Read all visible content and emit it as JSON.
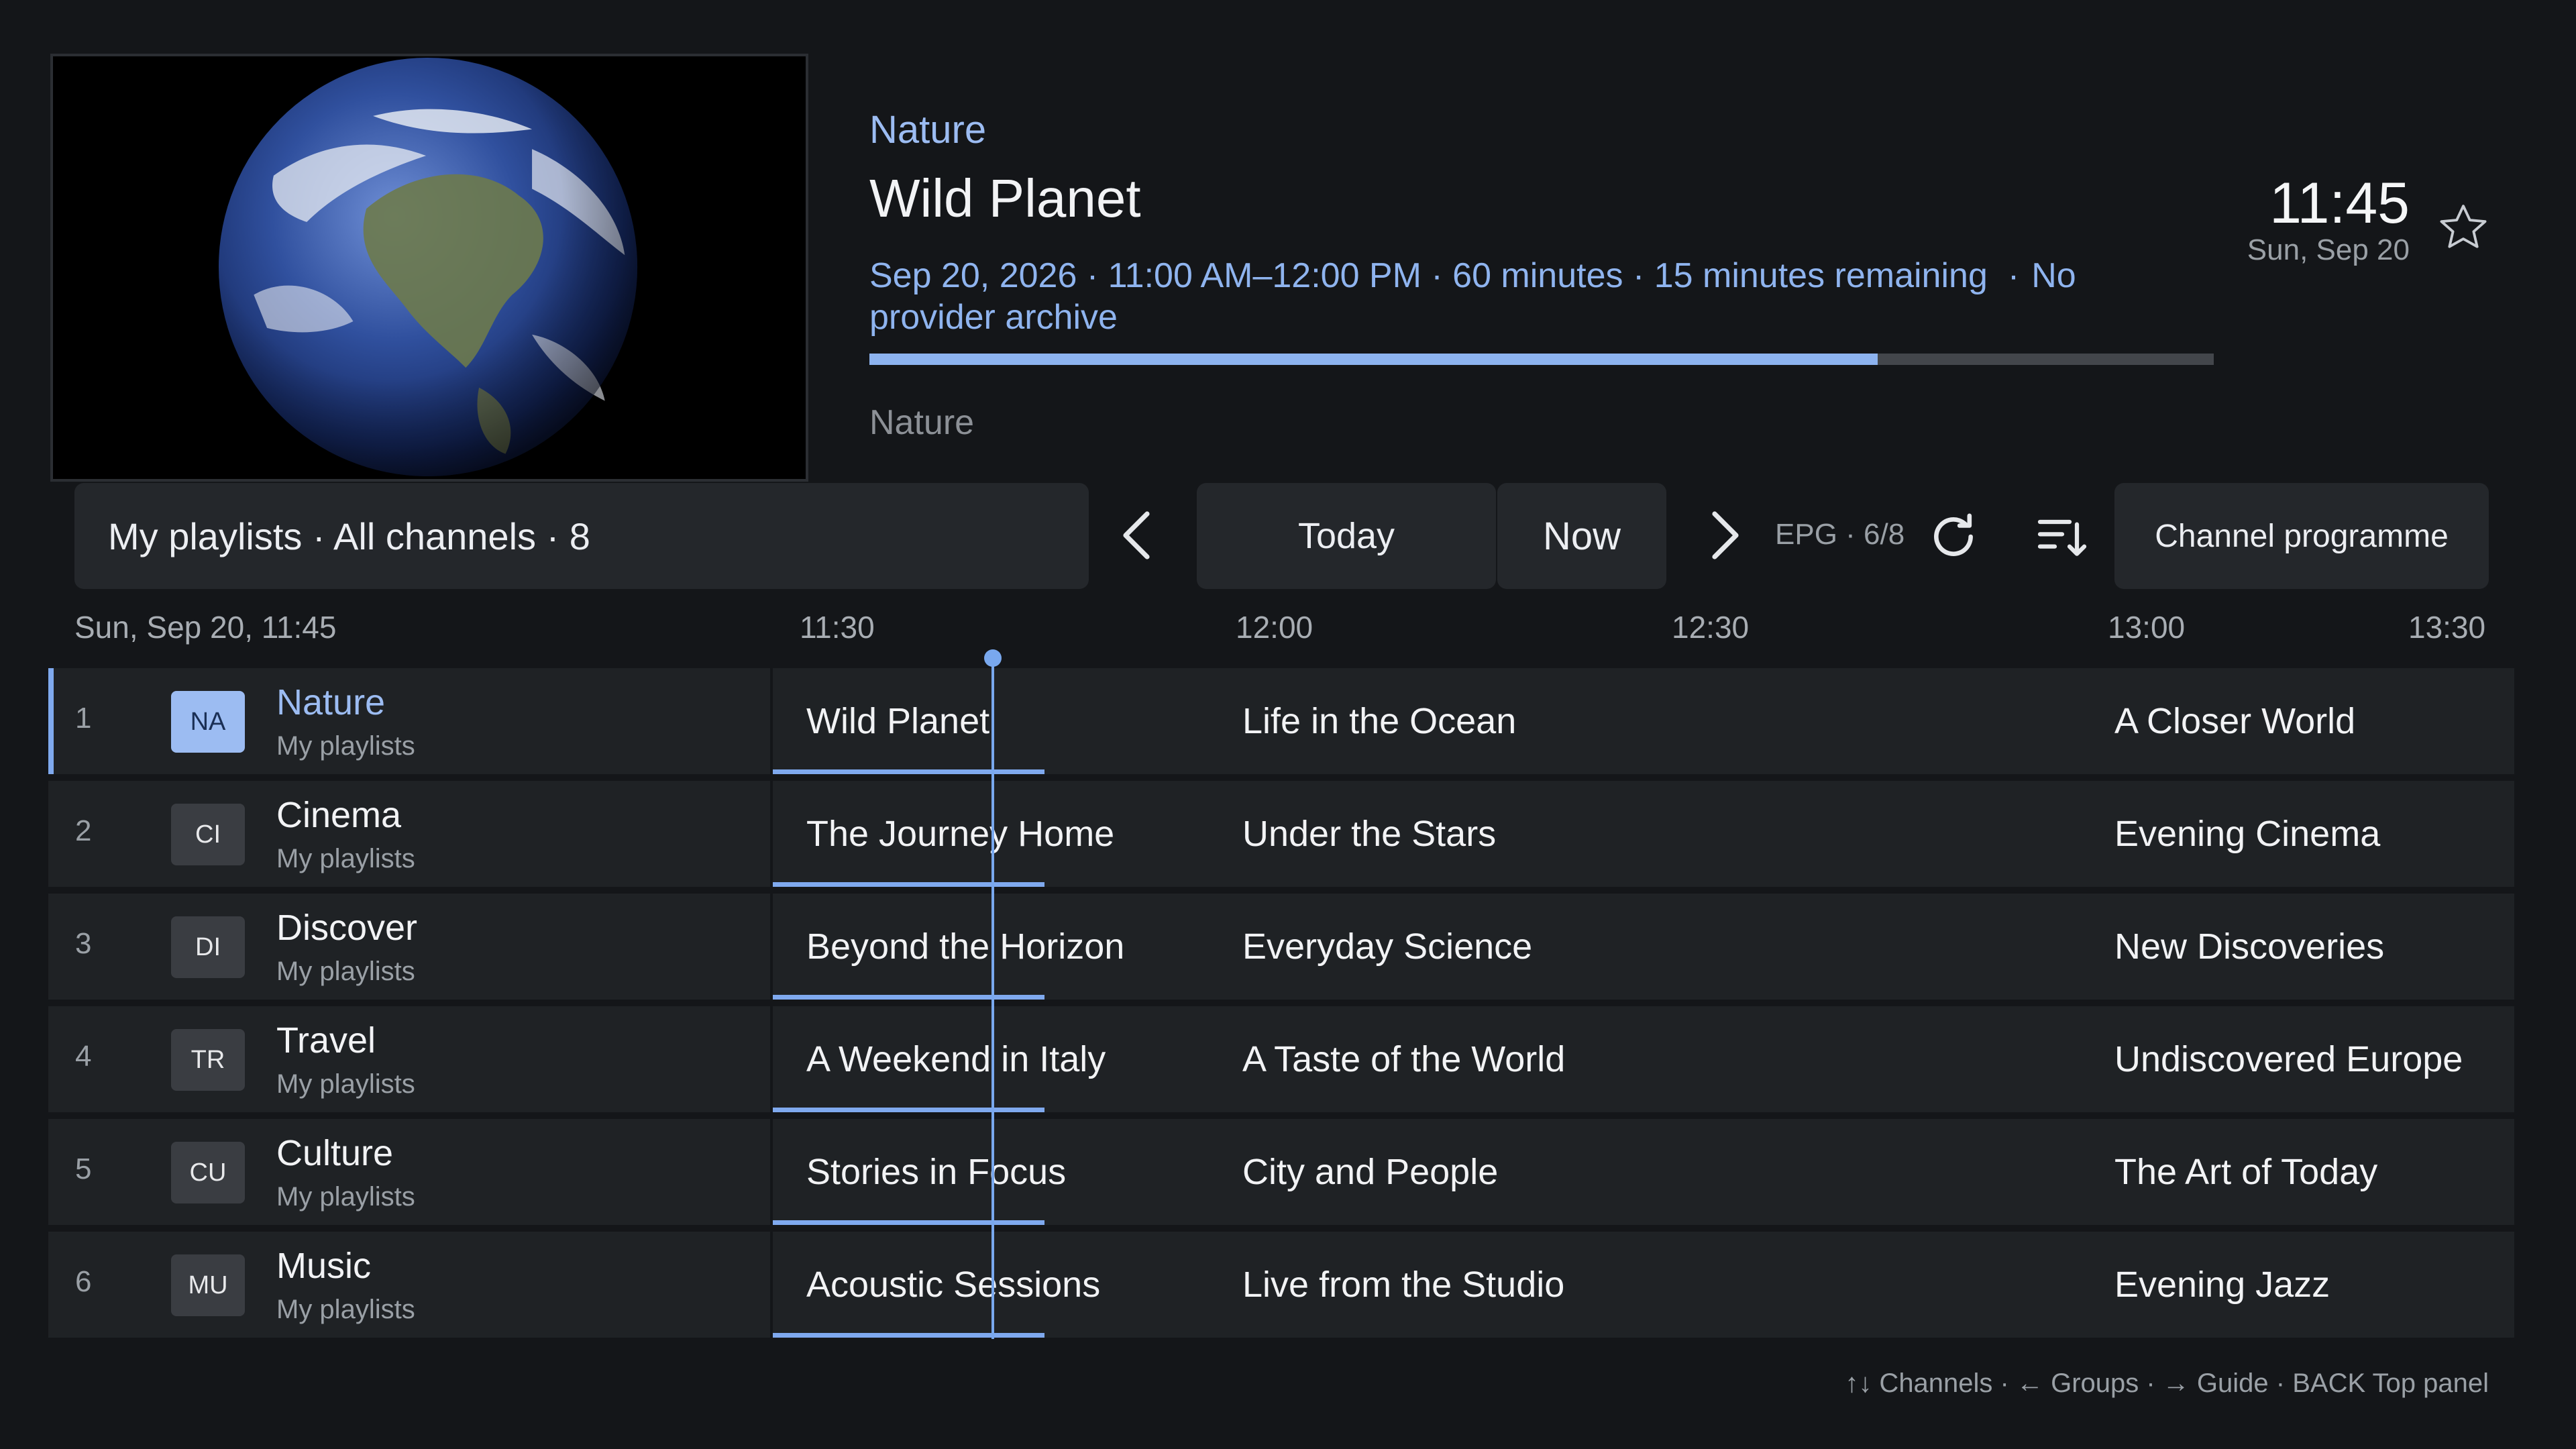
{
  "now_playing": {
    "category": "Nature",
    "title": "Wild Planet",
    "meta": "Sep 20, 2026 · 11:00 AM–12:00 PM · 60 minutes · 15 minutes remaining",
    "meta_separator": "·",
    "archive": "No provider archive",
    "progress_percent": 75,
    "genre": "Nature"
  },
  "clock": {
    "time": "11:45",
    "date": "Sun, Sep 20"
  },
  "toolbar": {
    "playlist": "My playlists · All channels · 8",
    "today_label": "Today",
    "now_label": "Now",
    "epg_status": "EPG · 6/8",
    "channel_programme_label": "Channel programme"
  },
  "timeline": {
    "date": "Sun, Sep 20, 11:45",
    "slots": [
      "11:30",
      "12:00",
      "12:30",
      "13:00",
      "13:30"
    ]
  },
  "channels": [
    {
      "number": "1",
      "logo": "NA",
      "name": "Nature",
      "group": "My playlists",
      "programs": [
        "Wild Planet",
        "Life in the Ocean",
        "A Closer World"
      ]
    },
    {
      "number": "2",
      "logo": "CI",
      "name": "Cinema",
      "group": "My playlists",
      "programs": [
        "The Journey Home",
        "Under the Stars",
        "Evening Cinema"
      ]
    },
    {
      "number": "3",
      "logo": "DI",
      "name": "Discover",
      "group": "My playlists",
      "programs": [
        "Beyond the Horizon",
        "Everyday Science",
        "New Discoveries"
      ]
    },
    {
      "number": "4",
      "logo": "TR",
      "name": "Travel",
      "group": "My playlists",
      "programs": [
        "A Weekend in Italy",
        "A Taste of the World",
        "Undiscovered Europe"
      ]
    },
    {
      "number": "5",
      "logo": "CU",
      "name": "Culture",
      "group": "My playlists",
      "programs": [
        "Stories in Focus",
        "City and People",
        "The Art of Today"
      ]
    },
    {
      "number": "6",
      "logo": "MU",
      "name": "Music",
      "group": "My playlists",
      "programs": [
        "Acoustic Sessions",
        "Live from the Studio",
        "Evening Jazz"
      ]
    }
  ],
  "help": "↑↓ Channels · ← Groups · → Guide · BACK Top panel",
  "icons": {
    "favorite": "star-outline-icon",
    "prev": "chevron-left-icon",
    "next": "chevron-right-icon",
    "refresh": "refresh-icon",
    "sort": "sort-icon"
  },
  "colors": {
    "accent": "#9cbcf2",
    "progress": "#8db3ef",
    "background": "#141619"
  }
}
